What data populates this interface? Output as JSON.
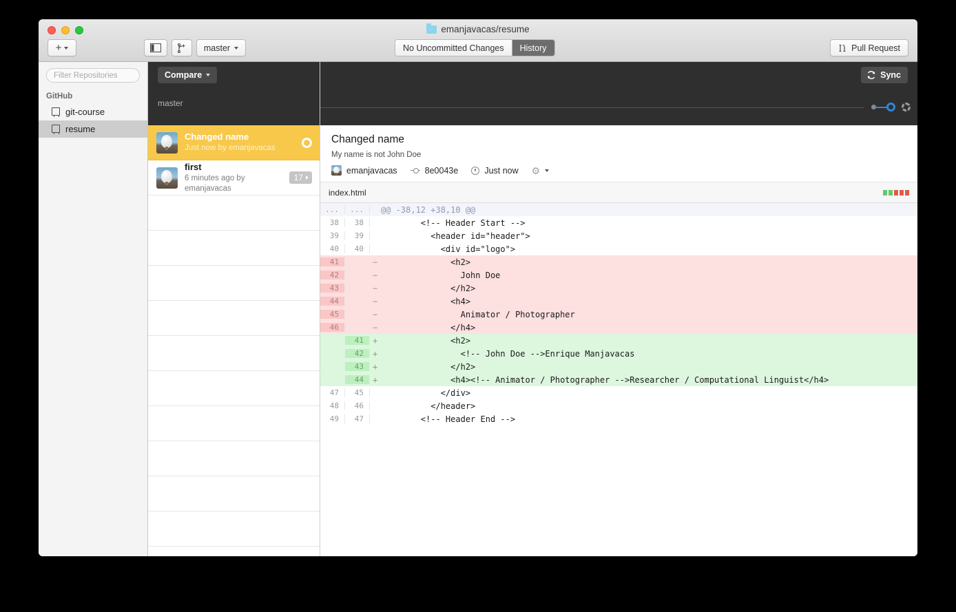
{
  "window": {
    "title": "emanjavacas/resume",
    "folder_icon": "folder-icon",
    "traffic_lights": [
      "close",
      "minimize",
      "zoom"
    ]
  },
  "toolbar": {
    "add_label": "+",
    "add_caret": "chevron-down-icon",
    "sidebar_toggle_icon": "sidebar-toggle-icon",
    "new_branch_icon": "new-branch-icon",
    "branch_label": "master",
    "segments": [
      {
        "label": "No Uncommitted Changes",
        "active": false
      },
      {
        "label": "History",
        "active": true
      }
    ],
    "pull_request_label": "Pull Request",
    "pull_request_icon": "pull-request-icon"
  },
  "sidebar": {
    "filter_placeholder": "Filter Repositories",
    "section_label": "GitHub",
    "repos": [
      {
        "name": "git-course",
        "selected": false
      },
      {
        "name": "resume",
        "selected": true
      }
    ]
  },
  "graph_bar": {
    "compare_label": "Compare",
    "compare_caret": "chevron-down-icon",
    "branch_label": "master",
    "sync_label": "Sync",
    "sync_icon": "sync-icon",
    "nodes": [
      {
        "type": "dot",
        "color": "#8a8a8a"
      },
      {
        "type": "current",
        "color": "#2f86d8"
      },
      {
        "type": "ghost",
        "color": "#9a9a9a"
      }
    ]
  },
  "commits": [
    {
      "title": "Changed name",
      "subtitle": "Just now by emanjavacas",
      "selected": true,
      "badge": null,
      "undo_ring": true
    },
    {
      "title": "first",
      "subtitle": "6 minutes ago by emanjavacas",
      "selected": false,
      "badge": "17",
      "undo_ring": false
    }
  ],
  "empty_rows": 11,
  "detail": {
    "title": "Changed name",
    "description": "My name is not John Doe",
    "author": "emanjavacas",
    "sha": "8e0043e",
    "time": "Just now",
    "gear_icon": "gear-icon",
    "gear_caret": "chevron-down-icon"
  },
  "file": {
    "name": "index.html",
    "stat_blocks": [
      "#63c96c",
      "#63c96c",
      "#e05a47",
      "#e05a47",
      "#e05a47"
    ]
  },
  "diff": {
    "lines": [
      {
        "type": "hunk",
        "old": "...",
        "new": "...",
        "sign": "",
        "code": "@@ -38,12 +38,10 @@"
      },
      {
        "type": "ctx",
        "old": "38",
        "new": "38",
        "sign": "",
        "code": "        <!-- Header Start -->"
      },
      {
        "type": "ctx",
        "old": "39",
        "new": "39",
        "sign": "",
        "code": "          <header id=\"header\">"
      },
      {
        "type": "ctx",
        "old": "40",
        "new": "40",
        "sign": "",
        "code": "            <div id=\"logo\">"
      },
      {
        "type": "del",
        "old": "41",
        "new": "",
        "sign": "−",
        "code": "              <h2>"
      },
      {
        "type": "del",
        "old": "42",
        "new": "",
        "sign": "−",
        "code": "                John Doe"
      },
      {
        "type": "del",
        "old": "43",
        "new": "",
        "sign": "−",
        "code": "              </h2>"
      },
      {
        "type": "del",
        "old": "44",
        "new": "",
        "sign": "−",
        "code": "              <h4>"
      },
      {
        "type": "del",
        "old": "45",
        "new": "",
        "sign": "−",
        "code": "                Animator / Photographer"
      },
      {
        "type": "del",
        "old": "46",
        "new": "",
        "sign": "−",
        "code": "              </h4>"
      },
      {
        "type": "add",
        "old": "",
        "new": "41",
        "sign": "+",
        "code": "              <h2>"
      },
      {
        "type": "add",
        "old": "",
        "new": "42",
        "sign": "+",
        "code": "                <!-- John Doe -->Enrique Manjavacas"
      },
      {
        "type": "add",
        "old": "",
        "new": "43",
        "sign": "+",
        "code": "              </h2>"
      },
      {
        "type": "add",
        "old": "",
        "new": "44",
        "sign": "+",
        "code": "              <h4><!-- Animator / Photographer -->Researcher / Computational Linguist</h4>"
      },
      {
        "type": "ctx",
        "old": "47",
        "new": "45",
        "sign": "",
        "code": "            </div>"
      },
      {
        "type": "ctx",
        "old": "48",
        "new": "46",
        "sign": "",
        "code": "          </header>"
      },
      {
        "type": "ctx",
        "old": "49",
        "new": "47",
        "sign": "",
        "code": "        <!-- Header End -->"
      }
    ]
  },
  "colors": {
    "accent_selected_commit": "#f7c84a",
    "graph_current": "#2f86d8",
    "diff_add_bg": "#ddf7de",
    "diff_del_bg": "#fde0e0",
    "dark_bar": "#2f2f2f"
  }
}
